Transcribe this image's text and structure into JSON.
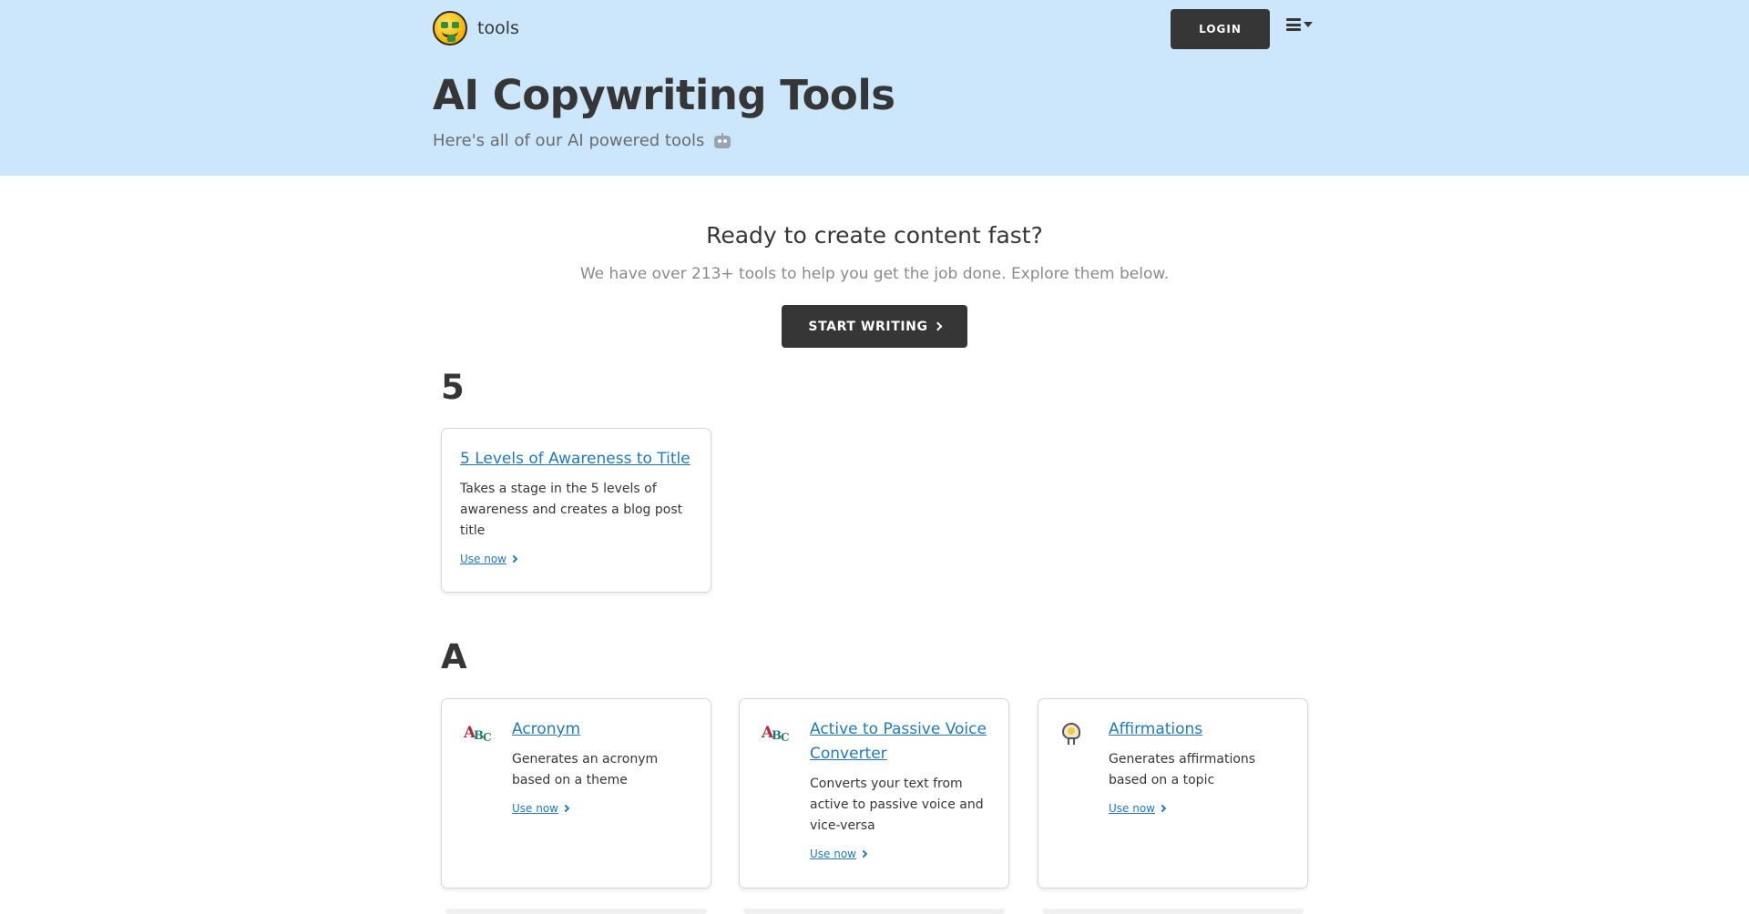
{
  "header": {
    "brand_text": "tools",
    "login_label": "LOGIN",
    "logo_icon": "money-mouth-face-icon",
    "menu_icon": "hamburger-menu-icon"
  },
  "hero": {
    "title": "AI Copywriting Tools",
    "subtitle": "Here's all of our AI powered tools",
    "subtitle_icon": "robot-icon"
  },
  "cta": {
    "title": "Ready to create content fast?",
    "text": "We have over 213+ tools to help you get the job done. Explore them below.",
    "button_label": "START WRITING"
  },
  "sections": [
    {
      "letter": "5",
      "tools": [
        {
          "title": "5 Levels of Awareness to Title",
          "description": "Takes a stage in the 5 levels of awareness and creates a blog post title",
          "link_label": "Use now",
          "icon": ""
        }
      ]
    },
    {
      "letter": "A",
      "tools": [
        {
          "title": "Acronym",
          "description": "Generates an acronym based on a theme",
          "link_label": "Use now",
          "icon": "abc-blocks-icon"
        },
        {
          "title": "Active to Passive Voice Converter",
          "description": "Converts your text from active to passive voice and vice-versa",
          "link_label": "Use now",
          "icon": "abc-blocks-icon"
        },
        {
          "title": "Affirmations",
          "description": "Generates affirmations based on a topic",
          "link_label": "Use now",
          "icon": "brain-lightbulb-icon"
        }
      ]
    }
  ],
  "colors": {
    "hero_bg": "#cce6fc",
    "button_dark": "#363636",
    "link": "#1f78c8"
  }
}
